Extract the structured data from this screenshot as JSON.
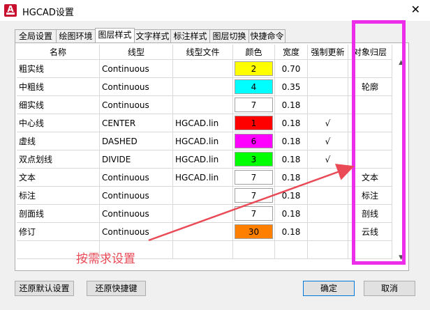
{
  "window": {
    "title": "HGCAD设置",
    "icon_label": "A"
  },
  "tabs": [
    {
      "label": "全局设置"
    },
    {
      "label": "绘图环境"
    },
    {
      "label": "图层样式"
    },
    {
      "label": "文字样式"
    },
    {
      "label": "标注样式"
    },
    {
      "label": "图层切换"
    },
    {
      "label": "快捷命令"
    }
  ],
  "active_tab": "图层样式",
  "table": {
    "headers": [
      "名称",
      "线型",
      "线型文件",
      "颜色",
      "宽度",
      "强制更新",
      "对象归层"
    ],
    "rows": [
      {
        "name": "粗实线",
        "linetype": "Continuous",
        "file": "",
        "color": "2",
        "color_hex": "#ffff00",
        "width": "0.70",
        "force": "",
        "layer": ""
      },
      {
        "name": "中粗线",
        "linetype": "Continuous",
        "file": "",
        "color": "4",
        "color_hex": "#00ffff",
        "width": "0.35",
        "force": "",
        "layer": "轮廓"
      },
      {
        "name": "细实线",
        "linetype": "Continuous",
        "file": "",
        "color": "7",
        "color_hex": "#ffffff",
        "width": "0.18",
        "force": "",
        "layer": ""
      },
      {
        "name": "中心线",
        "linetype": "CENTER",
        "file": "HGCAD.lin",
        "color": "1",
        "color_hex": "#ff0000",
        "width": "0.18",
        "force": "√",
        "layer": ""
      },
      {
        "name": "虚线",
        "linetype": "DASHED",
        "file": "HGCAD.lin",
        "color": "6",
        "color_hex": "#ff00ff",
        "width": "0.18",
        "force": "√",
        "layer": ""
      },
      {
        "name": "双点划线",
        "linetype": "DIVIDE",
        "file": "HGCAD.lin",
        "color": "3",
        "color_hex": "#00ff00",
        "width": "0.18",
        "force": "√",
        "layer": ""
      },
      {
        "name": "文本",
        "linetype": "Continuous",
        "file": "HGCAD.lin",
        "color": "7",
        "color_hex": "#ffffff",
        "width": "0.18",
        "force": "",
        "layer": "文本"
      },
      {
        "name": "标注",
        "linetype": "Continuous",
        "file": "",
        "color": "7",
        "color_hex": "#ffffff",
        "width": "0.18",
        "force": "",
        "layer": "标注"
      },
      {
        "name": "剖面线",
        "linetype": "Continuous",
        "file": "",
        "color": "7",
        "color_hex": "#ffffff",
        "width": "0.18",
        "force": "",
        "layer": "剖线"
      },
      {
        "name": "修订",
        "linetype": "Continuous",
        "file": "",
        "color": "30",
        "color_hex": "#ff7f00",
        "width": "0.18",
        "force": "",
        "layer": "云线"
      }
    ]
  },
  "annotation": {
    "text": "按需求设置",
    "color": "#e94a56",
    "highlight_color": "#ec2eea"
  },
  "buttons": {
    "restore_defaults": "还原默认设置",
    "restore_shortcuts": "还原快捷键",
    "ok": "确定",
    "cancel": "取消"
  },
  "icons": {
    "close": "close-icon",
    "scroll_up": "scroll-up-icon",
    "scroll_down": "scroll-down-icon"
  }
}
